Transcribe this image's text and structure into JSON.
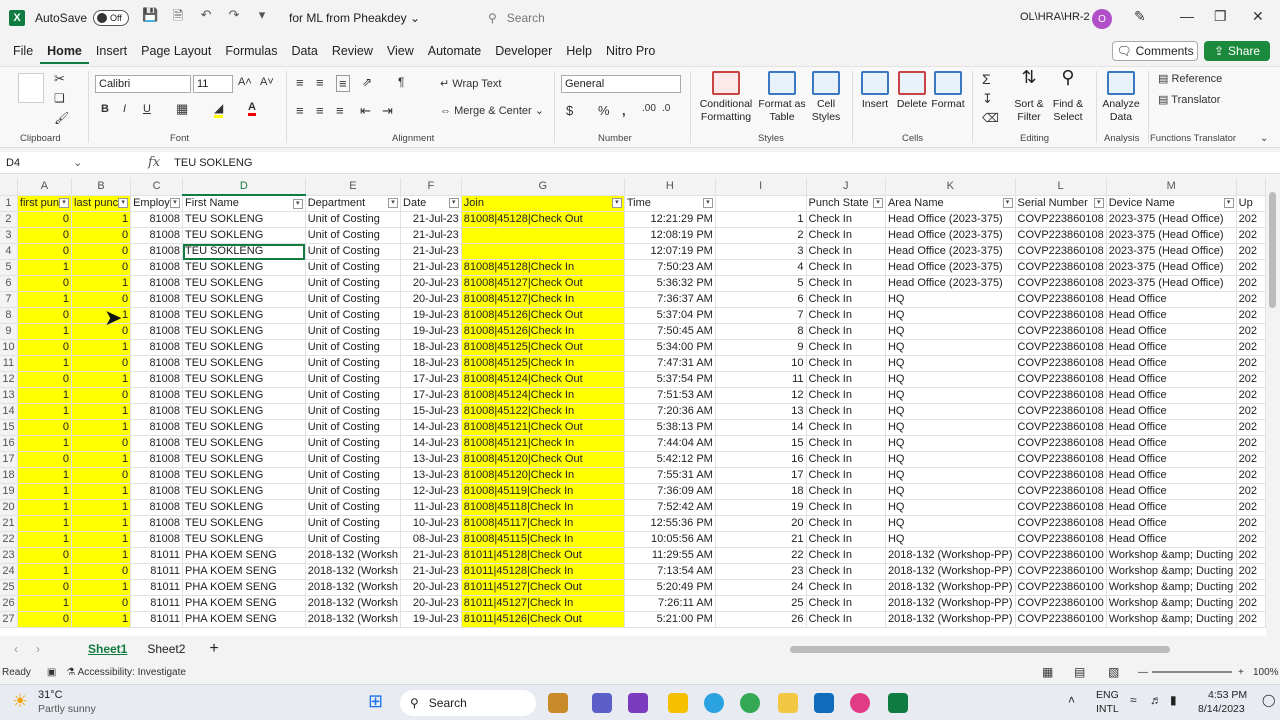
{
  "window": {
    "autosave_label": "AutoSave",
    "autosave_state": "Off",
    "doc_title": "for ML from Pheakdey",
    "search_placeholder": "Search",
    "path_label": "OL\\HRA\\HR-2",
    "avatar_initial": "O"
  },
  "menu": {
    "tabs": [
      "File",
      "Home",
      "Insert",
      "Page Layout",
      "Formulas",
      "Data",
      "Review",
      "View",
      "Automate",
      "Developer",
      "Help",
      "Nitro Pro"
    ],
    "active": "Home",
    "comments": "Comments",
    "share": "Share"
  },
  "ribbon": {
    "font_name": "Calibri",
    "font_size": "11",
    "wrap_text": "Wrap Text",
    "merge_center": "Merge & Center",
    "number_format": "General",
    "conditional_formatting_1": "Conditional",
    "conditional_formatting_2": "Formatting",
    "format_as_table_1": "Format as",
    "format_as_table_2": "Table",
    "cell_styles_1": "Cell",
    "cell_styles_2": "Styles",
    "insert": "Insert",
    "delete": "Delete",
    "format": "Format",
    "sort_filter_1": "Sort &",
    "sort_filter_2": "Filter",
    "find_select_1": "Find &",
    "find_select_2": "Select",
    "analyze_1": "Analyze",
    "analyze_2": "Data",
    "reference": "Reference",
    "translator": "Translator",
    "groups": {
      "clipboard": "Clipboard",
      "font": "Font",
      "alignment": "Alignment",
      "number": "Number",
      "styles": "Styles",
      "cells": "Cells",
      "editing": "Editing",
      "analysis": "Analysis",
      "functions_translator": "Functions Translator"
    }
  },
  "formula_bar": {
    "name_box": "D4",
    "fx": "fx",
    "content": "TEU SOKLENG"
  },
  "grid": {
    "columns": [
      "A",
      "B",
      "C",
      "D",
      "E",
      "F",
      "G",
      "H",
      "I",
      "J",
      "K",
      "L",
      "M"
    ],
    "headers": [
      "first pun",
      "last punc",
      "Employ",
      "First Name",
      "Department",
      "Date",
      "Join",
      "Time",
      "",
      "Punch State",
      "Area Name",
      "Serial Number",
      "Device Name",
      "Up"
    ],
    "rows": [
      [
        "0",
        "1",
        "81008",
        "TEU SOKLENG",
        "Unit of Costing",
        "21-Jul-23",
        "81008|45128|Check Out",
        "12:21:29 PM",
        "1",
        "Check In",
        "Head Office (2023-375)",
        "COVP223860108",
        "2023-375 (Head Office)",
        "202"
      ],
      [
        "0",
        "0",
        "81008",
        "TEU SOKLENG",
        "Unit of Costing",
        "21-Jul-23",
        "",
        "12:08:19 PM",
        "2",
        "Check In",
        "Head Office (2023-375)",
        "COVP223860108",
        "2023-375 (Head Office)",
        "202"
      ],
      [
        "0",
        "0",
        "81008",
        "TEU SOKLENG",
        "Unit of Costing",
        "21-Jul-23",
        "",
        "12:07:19 PM",
        "3",
        "Check In",
        "Head Office (2023-375)",
        "COVP223860108",
        "2023-375 (Head Office)",
        "202"
      ],
      [
        "1",
        "0",
        "81008",
        "TEU SOKLENG",
        "Unit of Costing",
        "21-Jul-23",
        "81008|45128|Check In",
        "7:50:23 AM",
        "4",
        "Check In",
        "Head Office (2023-375)",
        "COVP223860108",
        "2023-375 (Head Office)",
        "202"
      ],
      [
        "0",
        "1",
        "81008",
        "TEU SOKLENG",
        "Unit of Costing",
        "20-Jul-23",
        "81008|45127|Check Out",
        "5:36:32 PM",
        "5",
        "Check In",
        "Head Office (2023-375)",
        "COVP223860108",
        "2023-375 (Head Office)",
        "202"
      ],
      [
        "1",
        "0",
        "81008",
        "TEU SOKLENG",
        "Unit of Costing",
        "20-Jul-23",
        "81008|45127|Check In",
        "7:36:37 AM",
        "6",
        "Check In",
        "HQ",
        "COVP223860108",
        "Head Office",
        "202"
      ],
      [
        "0",
        "1",
        "81008",
        "TEU SOKLENG",
        "Unit of Costing",
        "19-Jul-23",
        "81008|45126|Check Out",
        "5:37:04 PM",
        "7",
        "Check In",
        "HQ",
        "COVP223860108",
        "Head Office",
        "202"
      ],
      [
        "1",
        "0",
        "81008",
        "TEU SOKLENG",
        "Unit of Costing",
        "19-Jul-23",
        "81008|45126|Check In",
        "7:50:45 AM",
        "8",
        "Check In",
        "HQ",
        "COVP223860108",
        "Head Office",
        "202"
      ],
      [
        "0",
        "1",
        "81008",
        "TEU SOKLENG",
        "Unit of Costing",
        "18-Jul-23",
        "81008|45125|Check Out",
        "5:34:00 PM",
        "9",
        "Check In",
        "HQ",
        "COVP223860108",
        "Head Office",
        "202"
      ],
      [
        "1",
        "0",
        "81008",
        "TEU SOKLENG",
        "Unit of Costing",
        "18-Jul-23",
        "81008|45125|Check In",
        "7:47:31 AM",
        "10",
        "Check In",
        "HQ",
        "COVP223860108",
        "Head Office",
        "202"
      ],
      [
        "0",
        "1",
        "81008",
        "TEU SOKLENG",
        "Unit of Costing",
        "17-Jul-23",
        "81008|45124|Check Out",
        "5:37:54 PM",
        "11",
        "Check In",
        "HQ",
        "COVP223860108",
        "Head Office",
        "202"
      ],
      [
        "1",
        "0",
        "81008",
        "TEU SOKLENG",
        "Unit of Costing",
        "17-Jul-23",
        "81008|45124|Check In",
        "7:51:53 AM",
        "12",
        "Check In",
        "HQ",
        "COVP223860108",
        "Head Office",
        "202"
      ],
      [
        "1",
        "1",
        "81008",
        "TEU SOKLENG",
        "Unit of Costing",
        "15-Jul-23",
        "81008|45122|Check In",
        "7:20:36 AM",
        "13",
        "Check In",
        "HQ",
        "COVP223860108",
        "Head Office",
        "202"
      ],
      [
        "0",
        "1",
        "81008",
        "TEU SOKLENG",
        "Unit of Costing",
        "14-Jul-23",
        "81008|45121|Check Out",
        "5:38:13 PM",
        "14",
        "Check In",
        "HQ",
        "COVP223860108",
        "Head Office",
        "202"
      ],
      [
        "1",
        "0",
        "81008",
        "TEU SOKLENG",
        "Unit of Costing",
        "14-Jul-23",
        "81008|45121|Check In",
        "7:44:04 AM",
        "15",
        "Check In",
        "HQ",
        "COVP223860108",
        "Head Office",
        "202"
      ],
      [
        "0",
        "1",
        "81008",
        "TEU SOKLENG",
        "Unit of Costing",
        "13-Jul-23",
        "81008|45120|Check Out",
        "5:42:12 PM",
        "16",
        "Check In",
        "HQ",
        "COVP223860108",
        "Head Office",
        "202"
      ],
      [
        "1",
        "0",
        "81008",
        "TEU SOKLENG",
        "Unit of Costing",
        "13-Jul-23",
        "81008|45120|Check In",
        "7:55:31 AM",
        "17",
        "Check In",
        "HQ",
        "COVP223860108",
        "Head Office",
        "202"
      ],
      [
        "1",
        "1",
        "81008",
        "TEU SOKLENG",
        "Unit of Costing",
        "12-Jul-23",
        "81008|45119|Check In",
        "7:36:09 AM",
        "18",
        "Check In",
        "HQ",
        "COVP223860108",
        "Head Office",
        "202"
      ],
      [
        "1",
        "1",
        "81008",
        "TEU SOKLENG",
        "Unit of Costing",
        "11-Jul-23",
        "81008|45118|Check In",
        "7:52:42 AM",
        "19",
        "Check In",
        "HQ",
        "COVP223860108",
        "Head Office",
        "202"
      ],
      [
        "1",
        "1",
        "81008",
        "TEU SOKLENG",
        "Unit of Costing",
        "10-Jul-23",
        "81008|45117|Check In",
        "12:55:36 PM",
        "20",
        "Check In",
        "HQ",
        "COVP223860108",
        "Head Office",
        "202"
      ],
      [
        "1",
        "1",
        "81008",
        "TEU SOKLENG",
        "Unit of Costing",
        "08-Jul-23",
        "81008|45115|Check In",
        "10:05:56 AM",
        "21",
        "Check In",
        "HQ",
        "COVP223860108",
        "Head Office",
        "202"
      ],
      [
        "0",
        "1",
        "81011",
        "PHA KOEM SENG",
        "2018-132 (Worksh",
        "21-Jul-23",
        "81011|45128|Check Out",
        "11:29:55 AM",
        "22",
        "Check In",
        "2018-132 (Workshop-PP)",
        "COVP223860100",
        "Workshop &amp; Ducting",
        "202"
      ],
      [
        "1",
        "0",
        "81011",
        "PHA KOEM SENG",
        "2018-132 (Worksh",
        "21-Jul-23",
        "81011|45128|Check In",
        "7:13:54 AM",
        "23",
        "Check In",
        "2018-132 (Workshop-PP)",
        "COVP223860100",
        "Workshop &amp; Ducting",
        "202"
      ],
      [
        "0",
        "1",
        "81011",
        "PHA KOEM SENG",
        "2018-132 (Worksh",
        "20-Jul-23",
        "81011|45127|Check Out",
        "5:20:49 PM",
        "24",
        "Check In",
        "2018-132 (Workshop-PP)",
        "COVP223860100",
        "Workshop &amp; Ducting",
        "202"
      ],
      [
        "1",
        "0",
        "81011",
        "PHA KOEM SENG",
        "2018-132 (Worksh",
        "20-Jul-23",
        "81011|45127|Check In",
        "7:26:11 AM",
        "25",
        "Check In",
        "2018-132 (Workshop-PP)",
        "COVP223860100",
        "Workshop &amp; Ducting",
        "202"
      ],
      [
        "0",
        "1",
        "81011",
        "PHA KOEM SENG",
        "2018-132 (Worksh",
        "19-Jul-23",
        "81011|45126|Check Out",
        "5:21:00 PM",
        "26",
        "Check In",
        "2018-132 (Workshop-PP)",
        "COVP223860100",
        "Workshop &amp; Ducting",
        "202"
      ]
    ]
  },
  "sheets": [
    "Sheet1",
    "Sheet2"
  ],
  "active_sheet": "Sheet1",
  "status": {
    "ready": "Ready",
    "accessibility": "Accessibility: Investigate",
    "zoom": "100%"
  },
  "taskbar": {
    "temp": "31°C",
    "weather": "Partly sunny",
    "search": "Search",
    "lang1": "ENG",
    "lang2": "INTL",
    "time": "4:53 PM",
    "date": "8/14/2023"
  },
  "colors": {
    "excel_green": "#107c41",
    "highlight_yellow": "#ffff00"
  }
}
